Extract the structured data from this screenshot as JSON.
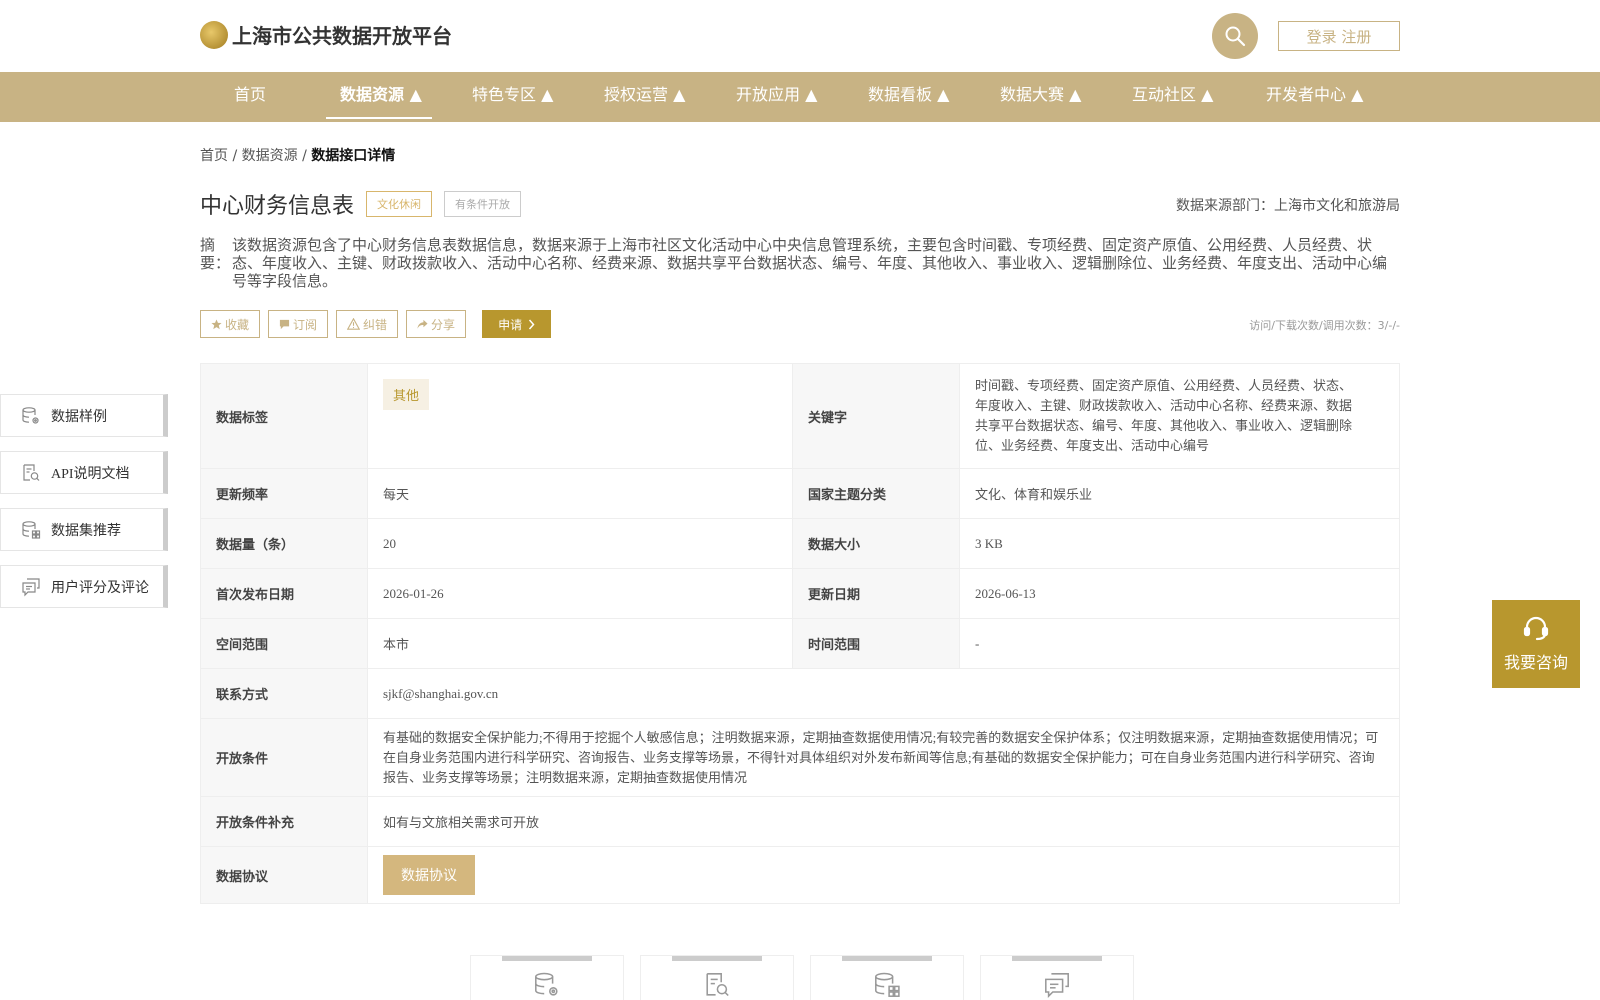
{
  "header": {
    "logo_icon": "logo-icon",
    "site_title": "上海市公共数据开放平台",
    "search_icon": "search-icon",
    "login_label": "登录 注册"
  },
  "nav": {
    "items": [
      {
        "label": "首页"
      },
      {
        "label": "数据资源 ▲"
      },
      {
        "label": "特色专区 ▲"
      },
      {
        "label": "授权运营 ▲"
      },
      {
        "label": "开放应用 ▲"
      },
      {
        "label": "数据看板 ▲"
      },
      {
        "label": "数据大赛 ▲"
      },
      {
        "label": "互动社区 ▲"
      },
      {
        "label": "开发者中心 ▲"
      }
    ],
    "active_index": 1
  },
  "breadcrumb": {
    "home": "首页",
    "sep1": "/",
    "section": "数据资源",
    "sep2": "/",
    "current": "数据接口详情"
  },
  "detail": {
    "title": "中心财务信息表",
    "tags": [
      "文化休闲",
      "有条件开放"
    ],
    "source": "数据来源部门：上海市文化和旅游局",
    "summary_label": "摘要：",
    "summary": "该数据资源包含了中心财务信息表数据信息，数据来源于上海市社区文化活动中心中央信息管理系统，主要包含时间戳、专项经费、固定资产原值、公用经费、人员经费、状态、年度收入、主键、财政拨款收入、活动中心名称、经费来源、数据共享平台数据状态、编号、年度、其他收入、事业收入、逻辑删除位、业务经费、年度支出、活动中心编号等字段信息。",
    "actions": [
      {
        "label": "收藏",
        "icon": "star-icon"
      },
      {
        "label": "订阅",
        "icon": "bookmark-icon"
      },
      {
        "label": "纠错",
        "icon": "warning-icon"
      },
      {
        "label": "分享",
        "icon": "share-icon"
      }
    ],
    "apply_label": "申请",
    "stats": "访问/下载次数/调用次数：3/-/-"
  },
  "sidebar": {
    "items": [
      {
        "label": "数据样例",
        "icon": "database-settings-icon"
      },
      {
        "label": "API说明文档",
        "icon": "document-search-icon"
      },
      {
        "label": "数据集推荐",
        "icon": "dataset-grid-icon"
      },
      {
        "label": "用户评分及评论",
        "icon": "comment-icon"
      }
    ]
  },
  "table": {
    "tag_label": "数据标签",
    "tag_value": "其他",
    "keyword_label": "关键字",
    "keyword_value": "时间戳、专项经费、固定资产原值、公用经费、人员经费、状态、年度收入、主键、财政拨款收入、活动中心名称、经费来源、数据共享平台数据状态、编号、年度、其他收入、事业收入、逻辑删除位、业务经费、年度支出、活动中心编号",
    "freq_label": "更新频率",
    "freq_value": "每天",
    "theme_label": "国家主题分类",
    "theme_value": "文化、体育和娱乐业",
    "count_label": "数据量（条）",
    "count_value": "20",
    "size_label": "数据大小",
    "size_value": "3 KB",
    "first_pub_label": "首次发布日期",
    "first_pub_value": "2026-01-26",
    "update_label": "更新日期",
    "update_value": "2026-06-13",
    "space_label": "空间范围",
    "space_value": "本市",
    "time_label": "时间范围",
    "time_value": "-",
    "contact_label": "联系方式",
    "contact_value": "sjkf@shanghai.gov.cn",
    "cond_label": "开放条件",
    "cond_value": "有基础的数据安全保护能力;不得用于挖掘个人敏感信息；注明数据来源，定期抽查数据使用情况;有较完善的数据安全保护体系；仅注明数据来源，定期抽查数据使用情况；可在自身业务范围内进行科学研究、咨询报告、业务支撑等场景，不得针对具体组织对外发布新闻等信息;有基础的数据安全保护能力；可在自身业务范围内进行科学研究、咨询报告、业务支撑等场景；注明数据来源，定期抽查数据使用情况",
    "cond_extra_label": "开放条件补充",
    "cond_extra_value": "如有与文旅相关需求可开放",
    "protocol_label": "数据协议",
    "protocol_button": "数据协议"
  },
  "consult": {
    "icon": "headset-icon",
    "label": "我要咨询"
  },
  "bottom_cards": [
    {
      "icon": "database-settings-icon"
    },
    {
      "icon": "document-search-icon"
    },
    {
      "icon": "dataset-grid-icon"
    },
    {
      "icon": "comment-icon"
    }
  ]
}
